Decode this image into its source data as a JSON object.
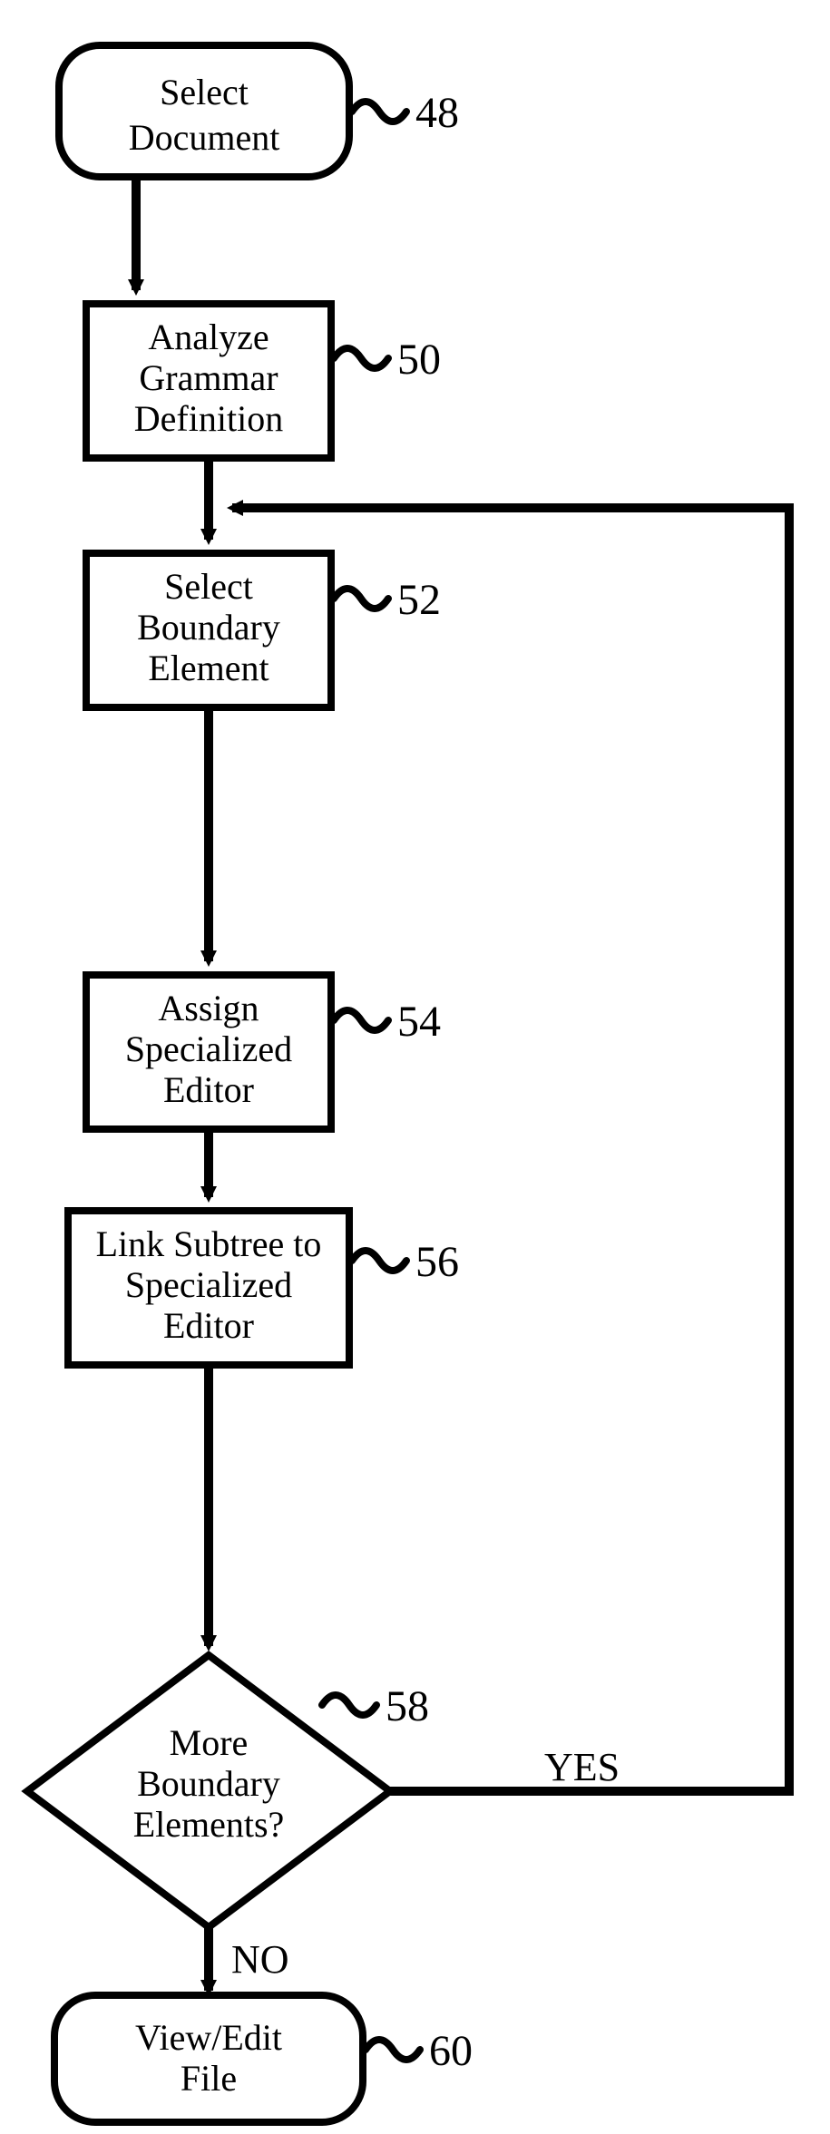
{
  "chart_data": {
    "type": "flowchart",
    "nodes": [
      {
        "id": "48",
        "shape": "terminator",
        "text_lines": [
          "Select",
          "Document"
        ],
        "label": "48"
      },
      {
        "id": "50",
        "shape": "process",
        "text_lines": [
          "Analyze",
          "Grammar",
          "Definition"
        ],
        "label": "50"
      },
      {
        "id": "52",
        "shape": "process",
        "text_lines": [
          "Select",
          "Boundary",
          "Element"
        ],
        "label": "52"
      },
      {
        "id": "54",
        "shape": "process",
        "text_lines": [
          "Assign",
          "Specialized",
          "Editor"
        ],
        "label": "54"
      },
      {
        "id": "56",
        "shape": "process",
        "text_lines": [
          "Link Subtree to",
          "Specialized",
          "Editor"
        ],
        "label": "56"
      },
      {
        "id": "58",
        "shape": "decision",
        "text_lines": [
          "More",
          "Boundary",
          "Elements?"
        ],
        "label": "58"
      },
      {
        "id": "60",
        "shape": "terminator",
        "text_lines": [
          "View/Edit",
          "File"
        ],
        "label": "60"
      }
    ],
    "edges": [
      {
        "from": "48",
        "to": "50",
        "label": ""
      },
      {
        "from": "50",
        "to": "52",
        "label": ""
      },
      {
        "from": "52",
        "to": "54",
        "label": ""
      },
      {
        "from": "54",
        "to": "56",
        "label": ""
      },
      {
        "from": "56",
        "to": "58",
        "label": ""
      },
      {
        "from": "58",
        "to": "60",
        "label": "NO"
      },
      {
        "from": "58",
        "to": "52",
        "label": "YES"
      }
    ],
    "edge_labels": {
      "no": "NO",
      "yes": "YES"
    }
  }
}
